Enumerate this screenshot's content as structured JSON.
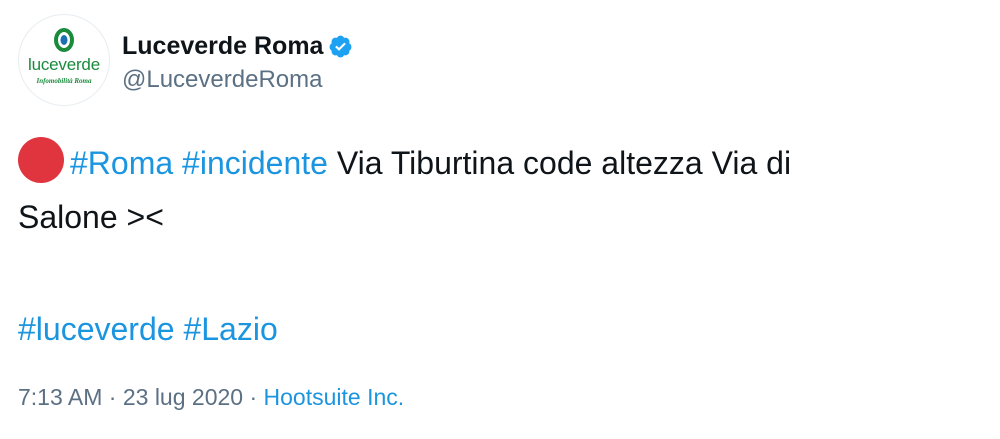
{
  "author": {
    "display_name": "Luceverde Roma",
    "handle": "@LuceverdeRoma",
    "verified": true,
    "avatar": {
      "logo_word": "luceverde",
      "logo_tagline": "Infomobilità Roma",
      "icon": "traffic-light-logo-icon"
    }
  },
  "tweet": {
    "emoji": "red-circle-icon",
    "line1": {
      "hashtag_1": "#Roma",
      "hashtag_2": "#incidente",
      "text": "Via Tiburtina code altezza Via di"
    },
    "line2": "Salone ><",
    "tags": {
      "tag_1": "#luceverde",
      "tag_2": "#Lazio"
    }
  },
  "meta": {
    "time": "7:13 AM",
    "separator": "·",
    "date": "23 lug 2020",
    "source": "Hootsuite Inc."
  },
  "colors": {
    "link": "#1b95e0",
    "text": "#0f1419",
    "muted": "#5b7083",
    "verified": "#1da1f2",
    "red_dot": "#e0343e",
    "brand_green": "#1a8a3c"
  }
}
